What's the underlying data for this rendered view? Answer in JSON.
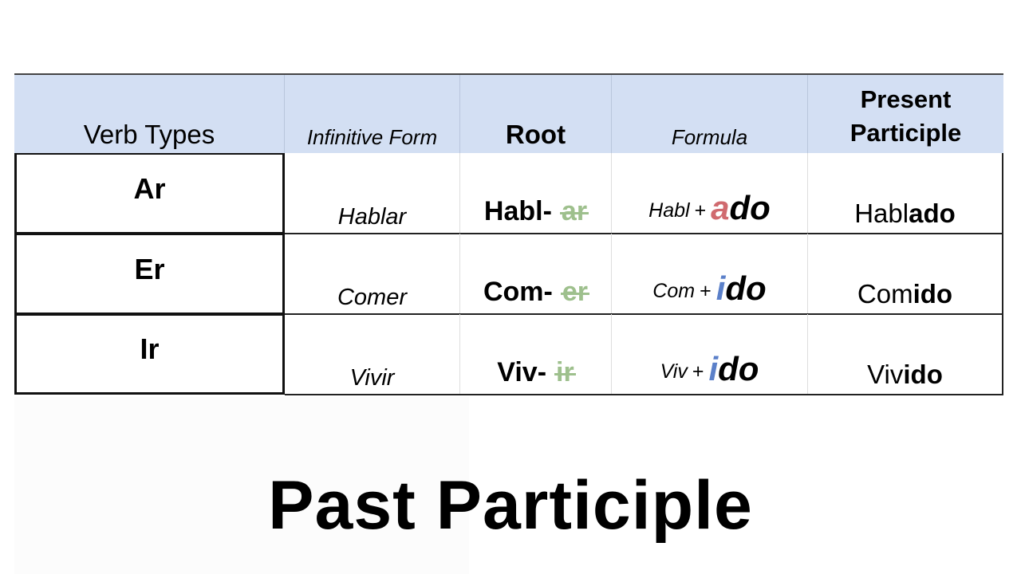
{
  "header": {
    "verb_types": "Verb Types",
    "infinitive_form": "Infinitive Form",
    "root": "Root",
    "formula": "Formula",
    "present_participle_line1": "Present",
    "present_participle_line2": "Participle"
  },
  "rows": [
    {
      "type": "Ar",
      "infinitive": "Hablar",
      "root": "Habl-",
      "ending": "ar",
      "formula_base": "Habl",
      "formula_plus": "+",
      "suffix_first": "a",
      "suffix_rest": "do",
      "pp_root": "Habl",
      "pp_suffix": "ado",
      "accent_color": "#d06a6f"
    },
    {
      "type": "Er",
      "infinitive": "Comer",
      "root": "Com-",
      "ending": "er",
      "formula_base": "Com",
      "formula_plus": "+",
      "suffix_first": "i",
      "suffix_rest": "do",
      "pp_root": "Com",
      "pp_suffix": "ido",
      "accent_color": "#5b80c9"
    },
    {
      "type": "Ir",
      "infinitive": "Vivir",
      "root": "Viv-",
      "ending": "ir",
      "formula_base": "Viv",
      "formula_plus": "+",
      "suffix_first": "i",
      "suffix_rest": "do",
      "pp_root": "Viv",
      "pp_suffix": "ido",
      "accent_color": "#5b80c9"
    }
  ],
  "colors": {
    "header_bg": "#d3dff3",
    "struck_ending": "#9ec08d",
    "ar_accent": "#d06a6f",
    "er_ir_accent": "#5b80c9"
  },
  "title": "Past Participle"
}
